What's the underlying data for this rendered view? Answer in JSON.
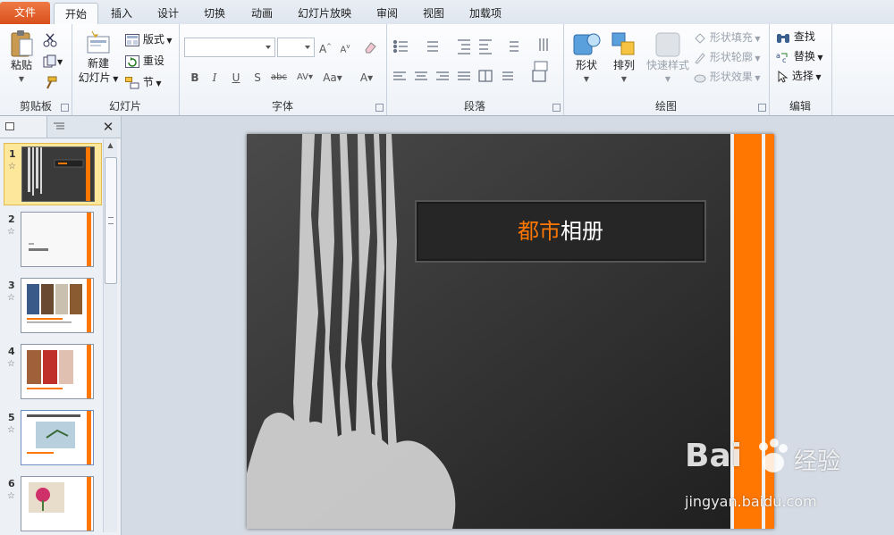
{
  "tabs": {
    "file": "文件",
    "home": "开始",
    "insert": "插入",
    "design": "设计",
    "transitions": "切换",
    "animations": "动画",
    "slideshow": "幻灯片放映",
    "review": "审阅",
    "view": "视图",
    "addins": "加载项"
  },
  "clipboard": {
    "label": "剪贴板",
    "paste": "粘贴"
  },
  "slides_group": {
    "label": "幻灯片",
    "new_slide_1": "新建",
    "new_slide_2": "幻灯片",
    "layout": "版式",
    "reset": "重设",
    "section": "节"
  },
  "font_group": {
    "label": "字体"
  },
  "paragraph_group": {
    "label": "段落"
  },
  "drawing_group": {
    "label": "绘图",
    "shape": "形状",
    "arrange": "排列",
    "quick_styles": "快速样式",
    "shape_fill": "形状填充",
    "shape_outline": "形状轮廓",
    "shape_effects": "形状效果"
  },
  "editing_group": {
    "label": "编辑",
    "find": "查找",
    "replace": "替换",
    "select": "选择"
  },
  "slides": [
    {
      "num": "1"
    },
    {
      "num": "2"
    },
    {
      "num": "3"
    },
    {
      "num": "4"
    },
    {
      "num": "5"
    },
    {
      "num": "6"
    }
  ],
  "slide": {
    "title_accent": "都市",
    "title_rest": "相册"
  },
  "watermark": {
    "brand": "Bai",
    "brand2": "经验",
    "url": "jingyan.baidu.com"
  },
  "colors": {
    "accent": "#ff7700",
    "file_tab": "#e06028",
    "selected_thumb": "#fde79b"
  }
}
